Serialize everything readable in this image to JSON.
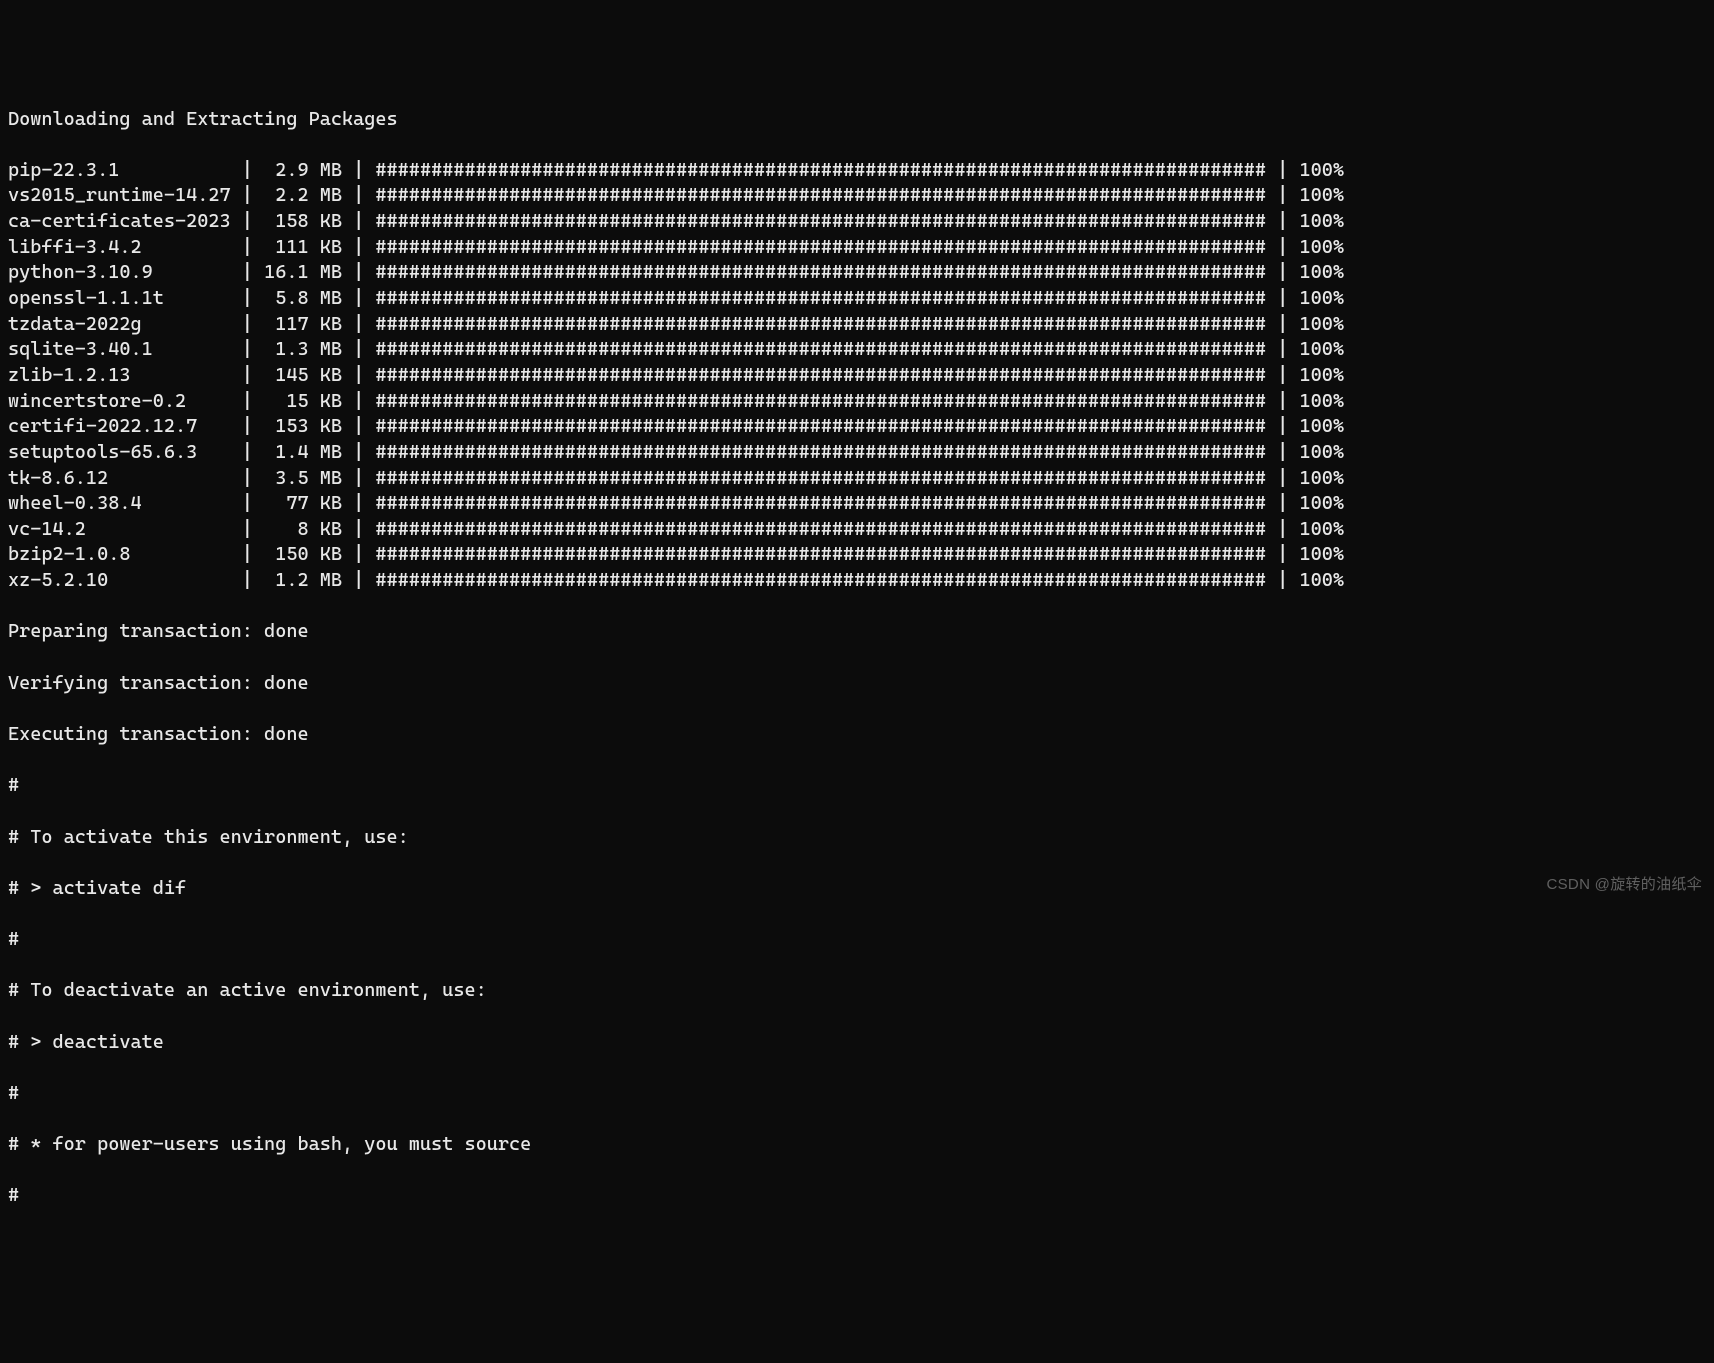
{
  "header": "Downloading and Extracting Packages",
  "bar_fill": "################################################################################",
  "packages": [
    {
      "name": "pip-22.3.1",
      "size": "2.9 MB",
      "percent": "100%"
    },
    {
      "name": "vs2015_runtime-14.27",
      "size": "2.2 MB",
      "percent": "100%"
    },
    {
      "name": "ca-certificates-2023",
      "size": "158 KB",
      "percent": "100%"
    },
    {
      "name": "libffi-3.4.2",
      "size": "111 KB",
      "percent": "100%"
    },
    {
      "name": "python-3.10.9",
      "size": "16.1 MB",
      "percent": "100%"
    },
    {
      "name": "openssl-1.1.1t",
      "size": "5.8 MB",
      "percent": "100%"
    },
    {
      "name": "tzdata-2022g",
      "size": "117 KB",
      "percent": "100%"
    },
    {
      "name": "sqlite-3.40.1",
      "size": "1.3 MB",
      "percent": "100%"
    },
    {
      "name": "zlib-1.2.13",
      "size": "145 KB",
      "percent": "100%"
    },
    {
      "name": "wincertstore-0.2",
      "size": "15 KB",
      "percent": "100%"
    },
    {
      "name": "certifi-2022.12.7",
      "size": "153 KB",
      "percent": "100%"
    },
    {
      "name": "setuptools-65.6.3",
      "size": "1.4 MB",
      "percent": "100%"
    },
    {
      "name": "tk-8.6.12",
      "size": "3.5 MB",
      "percent": "100%"
    },
    {
      "name": "wheel-0.38.4",
      "size": "77 KB",
      "percent": "100%"
    },
    {
      "name": "vc-14.2",
      "size": "8 KB",
      "percent": "100%"
    },
    {
      "name": "bzip2-1.0.8",
      "size": "150 KB",
      "percent": "100%"
    },
    {
      "name": "xz-5.2.10",
      "size": "1.2 MB",
      "percent": "100%"
    }
  ],
  "status": {
    "prepare": "Preparing transaction: done",
    "verify": "Verifying transaction: done",
    "execute": "Executing transaction: done"
  },
  "comments": {
    "c1": "#",
    "c2": "# To activate this environment, use:",
    "c3": "# > activate dif",
    "c4": "#",
    "c5": "# To deactivate an active environment, use:",
    "c6": "# > deactivate",
    "c7": "#",
    "c8": "# * for power-users using bash, you must source",
    "c9": "#"
  },
  "separators": {
    "pipe_space": " | ",
    "pipe_double": " | "
  },
  "watermark": "CSDN @旋转的油纸伞"
}
